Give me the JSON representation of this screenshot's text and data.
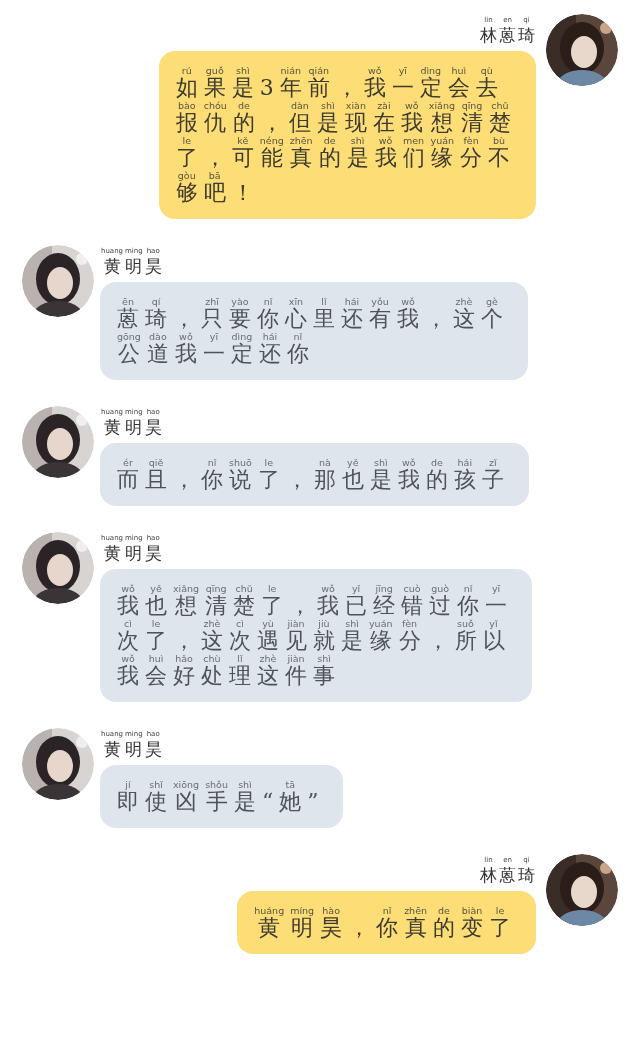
{
  "messages": [
    {
      "kind": "sent",
      "sender": [
        {
          "p": "lin",
          "c": "林"
        },
        {
          "p": "en",
          "c": "蒽"
        },
        {
          "p": "qi",
          "c": "琦"
        }
      ],
      "lines": [
        [
          {
            "p": "rú",
            "c": "如"
          },
          {
            "p": "guǒ",
            "c": "果"
          },
          {
            "p": "shì",
            "c": "是"
          },
          {
            "c": "3"
          },
          {
            "p": "nián",
            "c": "年"
          },
          {
            "p": "qián",
            "c": "前"
          },
          {
            "c": "，"
          },
          {
            "p": "wǒ",
            "c": "我"
          },
          {
            "p": "yī",
            "c": "一"
          },
          {
            "p": "dìng",
            "c": "定"
          },
          {
            "p": "huì",
            "c": "会"
          },
          {
            "p": "qù",
            "c": "去"
          }
        ],
        [
          {
            "p": "bào",
            "c": "报"
          },
          {
            "p": "chóu",
            "c": "仇"
          },
          {
            "p": "de",
            "c": "的"
          },
          {
            "c": "，"
          },
          {
            "p": "dàn",
            "c": "但"
          },
          {
            "p": "shì",
            "c": "是"
          },
          {
            "p": "xiàn",
            "c": "现"
          },
          {
            "p": "zài",
            "c": "在"
          },
          {
            "p": "wǒ",
            "c": "我"
          },
          {
            "p": "xiǎng",
            "c": "想"
          },
          {
            "p": "qīng",
            "c": "清"
          },
          {
            "p": "chǔ",
            "c": "楚"
          }
        ],
        [
          {
            "p": "le",
            "c": "了"
          },
          {
            "c": "，"
          },
          {
            "p": "kě",
            "c": "可"
          },
          {
            "p": "néng",
            "c": "能"
          },
          {
            "p": "zhēn",
            "c": "真"
          },
          {
            "p": "de",
            "c": "的"
          },
          {
            "p": "shì",
            "c": "是"
          },
          {
            "p": "wǒ",
            "c": "我"
          },
          {
            "p": "men",
            "c": "们"
          },
          {
            "p": "yuán",
            "c": "缘"
          },
          {
            "p": "fèn",
            "c": "分"
          },
          {
            "p": "bù",
            "c": "不"
          }
        ],
        [
          {
            "p": "gòu",
            "c": "够"
          },
          {
            "p": "bā",
            "c": "吧"
          },
          {
            "c": "！"
          }
        ]
      ]
    },
    {
      "kind": "received",
      "sender": [
        {
          "p": "huang",
          "c": "黄"
        },
        {
          "p": "ming",
          "c": "明"
        },
        {
          "p": "hao",
          "c": "昊"
        }
      ],
      "lines": [
        [
          {
            "p": "ēn",
            "c": "蒽"
          },
          {
            "p": "qí",
            "c": "琦"
          },
          {
            "c": "，"
          },
          {
            "p": "zhī",
            "c": "只"
          },
          {
            "p": "yào",
            "c": "要"
          },
          {
            "p": "nǐ",
            "c": "你"
          },
          {
            "p": "xīn",
            "c": "心"
          },
          {
            "p": "lǐ",
            "c": "里"
          },
          {
            "p": "hái",
            "c": "还"
          },
          {
            "p": "yǒu",
            "c": "有"
          },
          {
            "p": "wǒ",
            "c": "我"
          },
          {
            "c": "，"
          },
          {
            "p": "zhè",
            "c": "这"
          },
          {
            "p": "gè",
            "c": "个"
          }
        ],
        [
          {
            "p": "gōng",
            "c": "公"
          },
          {
            "p": "dào",
            "c": "道"
          },
          {
            "p": "wǒ",
            "c": "我"
          },
          {
            "p": "yī",
            "c": "一"
          },
          {
            "p": "dìng",
            "c": "定"
          },
          {
            "p": "hái",
            "c": "还"
          },
          {
            "p": "nǐ",
            "c": "你"
          }
        ]
      ]
    },
    {
      "kind": "received",
      "sender": [
        {
          "p": "huang",
          "c": "黄"
        },
        {
          "p": "ming",
          "c": "明"
        },
        {
          "p": "hao",
          "c": "昊"
        }
      ],
      "lines": [
        [
          {
            "p": "ér",
            "c": "而"
          },
          {
            "p": "qiě",
            "c": "且"
          },
          {
            "c": "，"
          },
          {
            "p": "nǐ",
            "c": "你"
          },
          {
            "p": "shuō",
            "c": "说"
          },
          {
            "p": "le",
            "c": "了"
          },
          {
            "c": "，"
          },
          {
            "p": "nà",
            "c": "那"
          },
          {
            "p": "yě",
            "c": "也"
          },
          {
            "p": "shì",
            "c": "是"
          },
          {
            "p": "wǒ",
            "c": "我"
          },
          {
            "p": "de",
            "c": "的"
          },
          {
            "p": "hái",
            "c": "孩"
          },
          {
            "p": "zǐ",
            "c": "子"
          }
        ]
      ]
    },
    {
      "kind": "received",
      "sender": [
        {
          "p": "huang",
          "c": "黄"
        },
        {
          "p": "ming",
          "c": "明"
        },
        {
          "p": "hao",
          "c": "昊"
        }
      ],
      "lines": [
        [
          {
            "p": "wǒ",
            "c": "我"
          },
          {
            "p": "yě",
            "c": "也"
          },
          {
            "p": "xiǎng",
            "c": "想"
          },
          {
            "p": "qīng",
            "c": "清"
          },
          {
            "p": "chǔ",
            "c": "楚"
          },
          {
            "p": "le",
            "c": "了"
          },
          {
            "c": "，"
          },
          {
            "p": "wǒ",
            "c": "我"
          },
          {
            "p": "yǐ",
            "c": "已"
          },
          {
            "p": "jīng",
            "c": "经"
          },
          {
            "p": "cuò",
            "c": "错"
          },
          {
            "p": "guò",
            "c": "过"
          },
          {
            "p": "nǐ",
            "c": "你"
          },
          {
            "p": "yī",
            "c": "一"
          }
        ],
        [
          {
            "p": "cì",
            "c": "次"
          },
          {
            "p": "le",
            "c": "了"
          },
          {
            "c": "，"
          },
          {
            "p": "zhè",
            "c": "这"
          },
          {
            "p": "cì",
            "c": "次"
          },
          {
            "p": "yù",
            "c": "遇"
          },
          {
            "p": "jiàn",
            "c": "见"
          },
          {
            "p": "jiù",
            "c": "就"
          },
          {
            "p": "shì",
            "c": "是"
          },
          {
            "p": "yuán",
            "c": "缘"
          },
          {
            "p": "fèn",
            "c": "分"
          },
          {
            "c": "，"
          },
          {
            "p": "suǒ",
            "c": "所"
          },
          {
            "p": "yǐ",
            "c": "以"
          }
        ],
        [
          {
            "p": "wǒ",
            "c": "我"
          },
          {
            "p": "huì",
            "c": "会"
          },
          {
            "p": "hǎo",
            "c": "好"
          },
          {
            "p": "chù",
            "c": "处"
          },
          {
            "p": "lǐ",
            "c": "理"
          },
          {
            "p": "zhè",
            "c": "这"
          },
          {
            "p": "jiàn",
            "c": "件"
          },
          {
            "p": "shì",
            "c": "事"
          }
        ]
      ]
    },
    {
      "kind": "received",
      "sender": [
        {
          "p": "huang",
          "c": "黄"
        },
        {
          "p": "ming",
          "c": "明"
        },
        {
          "p": "hao",
          "c": "昊"
        }
      ],
      "lines": [
        [
          {
            "p": "jí",
            "c": "即"
          },
          {
            "p": "shǐ",
            "c": "使"
          },
          {
            "p": "xiōng",
            "c": "凶"
          },
          {
            "p": "shǒu",
            "c": "手"
          },
          {
            "p": "shì",
            "c": "是"
          },
          {
            "c": "“"
          },
          {
            "p": "tā",
            "c": "她"
          },
          {
            "c": "”"
          }
        ]
      ]
    },
    {
      "kind": "sent",
      "sender": [
        {
          "p": "lin",
          "c": "林"
        },
        {
          "p": "en",
          "c": "蒽"
        },
        {
          "p": "qi",
          "c": "琦"
        }
      ],
      "lines": [
        [
          {
            "p": "huáng",
            "c": "黄"
          },
          {
            "p": "míng",
            "c": "明"
          },
          {
            "p": "hào",
            "c": "昊"
          },
          {
            "c": "，"
          },
          {
            "p": "nǐ",
            "c": "你"
          },
          {
            "p": "zhēn",
            "c": "真"
          },
          {
            "p": "de",
            "c": "的"
          },
          {
            "p": "biàn",
            "c": "变"
          },
          {
            "p": "le",
            "c": "了"
          }
        ]
      ]
    }
  ]
}
